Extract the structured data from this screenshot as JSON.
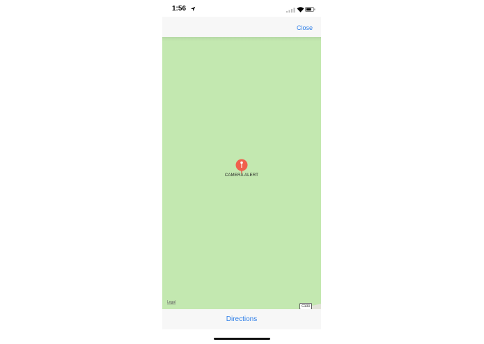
{
  "status_bar": {
    "time": "1:56",
    "icons": [
      "location-arrow-icon",
      "signal-icon",
      "wifi-icon",
      "battery-icon"
    ]
  },
  "nav": {
    "close_label": "Close"
  },
  "map": {
    "pin_label": "CAMERA ALERT",
    "legal_label": "Legal",
    "road_label": "C103",
    "colors": {
      "land": "#c3e8b0",
      "pin": "#f0604d"
    }
  },
  "toolbar": {
    "directions_label": "Directions"
  },
  "colors": {
    "accent": "#2f7fe8"
  }
}
